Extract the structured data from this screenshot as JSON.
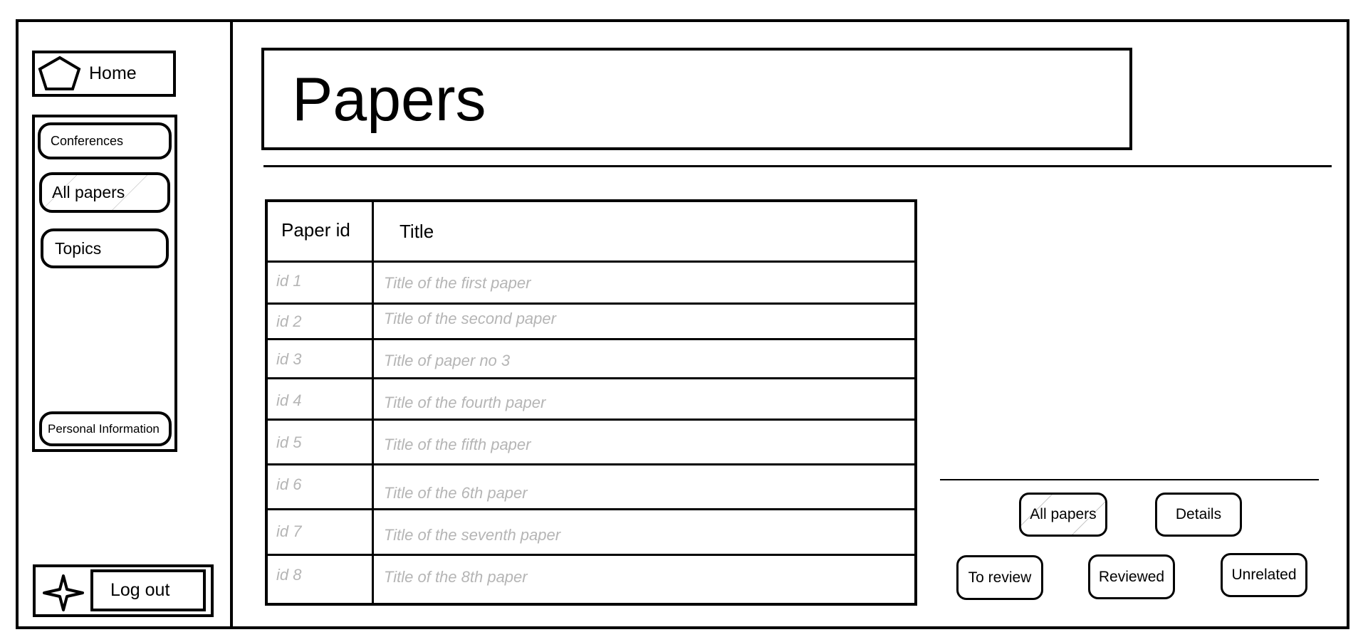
{
  "sidebar": {
    "home_label": "Home",
    "home_icon": "pentagon-icon",
    "items": [
      {
        "label": "Conferences"
      },
      {
        "label": "All papers",
        "selected": true
      },
      {
        "label": "Topics"
      },
      {
        "label": "Personal Information"
      }
    ],
    "logout_label": "Log out",
    "logout_icon": "star-icon"
  },
  "header": {
    "title": "Papers"
  },
  "table": {
    "columns": [
      "Paper id",
      "Title"
    ],
    "rows": [
      {
        "id": "id 1",
        "title": "Title of the first paper"
      },
      {
        "id": "id 2",
        "title": "Title of the second paper"
      },
      {
        "id": "id 3",
        "title": "Title of paper no 3"
      },
      {
        "id": "id 4",
        "title": "Title of the fourth paper"
      },
      {
        "id": "id 5",
        "title": "Title of the fifth paper"
      },
      {
        "id": "id 6",
        "title": "Title of the 6th paper"
      },
      {
        "id": "id 7",
        "title": "Title of the seventh paper"
      },
      {
        "id": "id 8",
        "title": "Title of the 8th paper"
      }
    ]
  },
  "actions": {
    "all_papers": "All papers",
    "details": "Details",
    "to_review": "To review",
    "reviewed": "Reviewed",
    "unrelated": "Unrelated"
  },
  "colors": {
    "line": "#000000",
    "placeholder_text": "#b5b5b5"
  }
}
